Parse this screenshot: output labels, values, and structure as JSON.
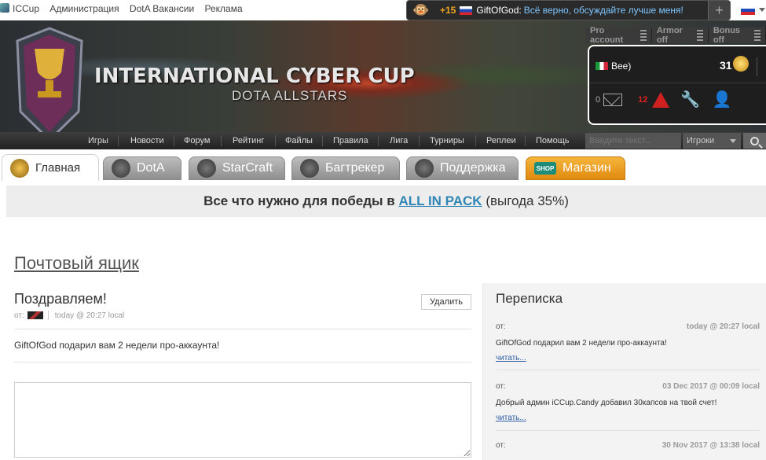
{
  "top_links": [
    "ICCup",
    "Администрация",
    "DotA Вакансии",
    "Реклама"
  ],
  "notification": {
    "points": "+15",
    "nick": "GiftOfGod:",
    "message": "Всё верно, обсуждайте лучше меня!",
    "add_label": "+"
  },
  "banner": {
    "title": "INTERNATIONAL CYBER CUP",
    "subtitle": "DOTA ALLSTARS"
  },
  "account": {
    "tabs": [
      "Pro account",
      "Armor off",
      "Bonus off"
    ],
    "username": "Bee)",
    "money": "31",
    "mail_count": "0",
    "alert_count": "12"
  },
  "nav": {
    "items": [
      "Игры",
      "Новости",
      "Форум",
      "Рейтинг",
      "Файлы",
      "Правила",
      "Лига",
      "Турниры",
      "Реплеи",
      "Помощь"
    ],
    "search_placeholder": "Введите текст...",
    "search_scope": "Игроки"
  },
  "tabs": [
    "Главная",
    "DotA",
    "StarCraft",
    "Багтрекер",
    "Поддержка",
    "Магазин"
  ],
  "shop_badge": "SHOP",
  "promo": {
    "lead": "Все что нужно для победы в",
    "link": "ALL IN PACK",
    "tail": "(выгода 35%)"
  },
  "mailbox": {
    "title": "Почтовый ящик",
    "subject": "Поздравляем!",
    "delete_label": "Удалить",
    "from_label": "от:",
    "time": "today @ 20:27 local",
    "body": "GiftOfGod подарил вам 2 недели про-аккаунта!"
  },
  "sidebar": {
    "title": "Переписка",
    "conversations": [
      {
        "from": "от:",
        "time": "today @ 20:27 local",
        "text": "GiftOfGod подарил вам 2 недели про-аккаунта!",
        "read": "читать..."
      },
      {
        "from": "от:",
        "time": "03 Dec 2017 @ 00:09 local",
        "text": "Добрый админ iCCup.Candy добавил 30капсов на твой счет!",
        "read": "читать..."
      },
      {
        "from": "от:",
        "time": "30 Nov 2017 @ 13:38 local"
      }
    ]
  },
  "colors": {
    "link": "#2f86b5",
    "alert": "#e02020",
    "shop_tab": "#f0a623",
    "nav_bg": "#2e2e2e"
  }
}
